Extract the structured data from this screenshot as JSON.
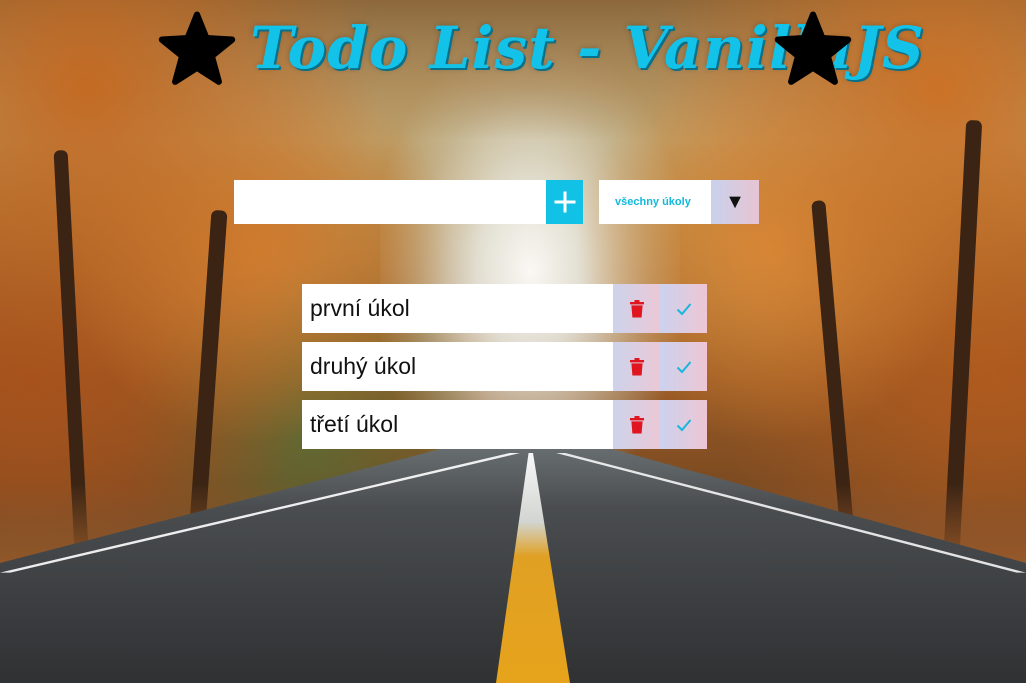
{
  "header": {
    "title": "Todo List - VanillaJS",
    "left_icon": "star-icon",
    "right_icon": "star-icon"
  },
  "form": {
    "input_value": "",
    "input_placeholder": "",
    "add_icon": "plus-icon",
    "filter_selected": "všechny úkoly",
    "filter_arrow": "▼"
  },
  "todos": [
    {
      "text": "první úkol",
      "delete_icon": "trash-icon",
      "complete_icon": "check-icon"
    },
    {
      "text": "druhý úkol",
      "delete_icon": "trash-icon",
      "complete_icon": "check-icon"
    },
    {
      "text": "třetí úkol",
      "delete_icon": "trash-icon",
      "complete_icon": "check-icon"
    }
  ],
  "colors": {
    "accent": "#11c2e6",
    "title": "#13c2e8",
    "delete": "#e0151f",
    "check": "#19b6dc"
  }
}
